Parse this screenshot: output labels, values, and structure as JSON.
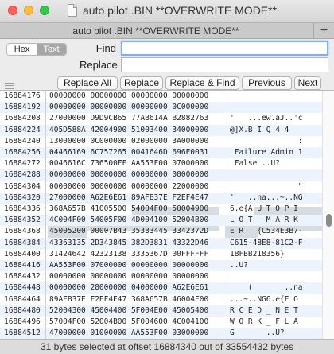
{
  "window": {
    "title": "auto pilot .BIN **OVERWRITE MODE**",
    "tab_label": "auto pilot .BIN **OVERWRITE MODE**",
    "add_tab_glyph": "+"
  },
  "find_panel": {
    "mode_options": [
      "Hex",
      "Text"
    ],
    "selected_mode": "Text",
    "find_label": "Find",
    "find_value": "",
    "replace_label": "Replace",
    "replace_value": ""
  },
  "buttons": {
    "replace_all": "Replace All",
    "replace": "Replace",
    "replace_and_find": "Replace & Find",
    "previous": "Previous",
    "next": "Next"
  },
  "rows": [
    {
      "offset": "16884176",
      "hex": "00000000 00000000 00000000 00000000",
      "ascii": ""
    },
    {
      "offset": "16884192",
      "hex": "00000000 00000000 00000000 0C000000",
      "ascii": ""
    },
    {
      "offset": "16884208",
      "hex": "27000000 D9D9CB65 77AB614A B2882763",
      "ascii": "'   ...ew.aJ..'c"
    },
    {
      "offset": "16884224",
      "hex": "405D588A 42004900 51003400 34000000",
      "ascii": "@]X.B I Q 4 4"
    },
    {
      "offset": "16884240",
      "hex": "13000000 0C000000 02000000 3A000000",
      "ascii": "               :"
    },
    {
      "offset": "16884256",
      "hex": "04466169 6C757265 0041646D 696E0031",
      "ascii": " Failure Admin 1"
    },
    {
      "offset": "16884272",
      "hex": "0046616C 736500FF AA553F00 07000000",
      "ascii": " False ..U?"
    },
    {
      "offset": "16884288",
      "hex": "00000000 00000000 00000000 00000000",
      "ascii": ""
    },
    {
      "offset": "16884304",
      "hex": "00000000 00000000 00000000 22000000",
      "ascii": "               \""
    },
    {
      "offset": "16884320",
      "hex": "27000000 A62E6E61 89AFB37E F2EF4E47",
      "ascii": "'   ..na...~..NG"
    },
    {
      "offset": "16884336",
      "hex": "368A657B 41005500 54004F00 50004900",
      "ascii": "6.e{A U T O P I"
    },
    {
      "offset": "16884352",
      "hex": "4C004F00 54005F00 4D004100 52004B00",
      "ascii": "L O T _ M A R K"
    },
    {
      "offset": "16884368",
      "hex": "45005200 00007B43 35333445 3342372D",
      "ascii": "E R   {C534E3B7-"
    },
    {
      "offset": "16884384",
      "hex": "43363135 2D343845 382D3831 43322D46",
      "ascii": "C615-48E8-81C2-F"
    },
    {
      "offset": "16884400",
      "hex": "31424642 42323138 3335367D 00FFFFFF",
      "ascii": "1BFBB218356}"
    },
    {
      "offset": "16884416",
      "hex": "AA553F00 07000000 00000000 00000000",
      "ascii": "..U?"
    },
    {
      "offset": "16884432",
      "hex": "00000000 00000000 00000000 00000000",
      "ascii": ""
    },
    {
      "offset": "16884448",
      "hex": "00000000 28000000 04000000 A62E6E61",
      "ascii": "    (       ..na"
    },
    {
      "offset": "16884464",
      "hex": "89AFB37E F2EF4E47 368A657B 46004F00",
      "ascii": "...~..NG6.e{F O"
    },
    {
      "offset": "16884480",
      "hex": "52004300 45004400 5F004E00 45005400",
      "ascii": "R C E D _ N E T"
    },
    {
      "offset": "16884496",
      "hex": "57004F00 52004B00 5F004600 4C004100",
      "ascii": "W O R K _ F L A"
    },
    {
      "offset": "16884512",
      "hex": "47000000 01000000 AA553F00 03000000",
      "ascii": "G       ..U?"
    }
  ],
  "status": {
    "text": "31 bytes selected at offset 16884340 out of 33554432 bytes"
  },
  "colors": {
    "row_alt": "#edf3fc",
    "selection": "#d7dce3",
    "find_focus": "#7fb0eb"
  }
}
